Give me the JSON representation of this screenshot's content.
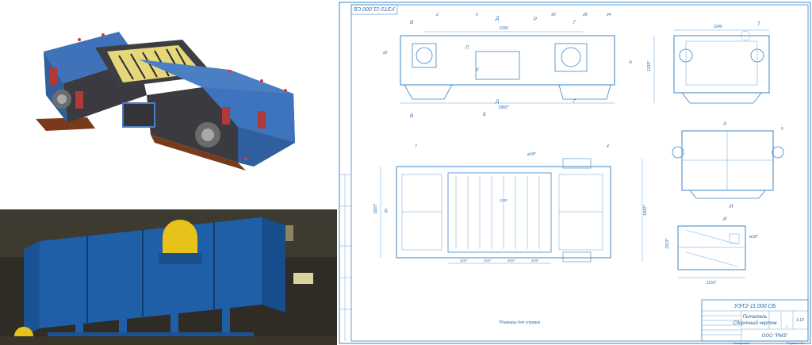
{
  "render": {
    "alt": "3D model of feeder"
  },
  "photo": {
    "alt": "Photo of assembled feeder in workshop"
  },
  "drawing": {
    "stamp_top": "УЭТ2-11.000 СБ",
    "views": {
      "a": "А",
      "b": "Б",
      "v": "В",
      "g": "Г",
      "d": "Д",
      "i": "И",
      "p": "П",
      "r": "Р",
      "t": "Т",
      "u": "У"
    },
    "dims": {
      "d1": "1240",
      "d2": "3965*",
      "d3": "1240",
      "d4": "1235*",
      "d5": "1503*",
      "d6": "1120",
      "d7": "1820*",
      "d8": "1800*",
      "d9": "415*",
      "d10": "415*",
      "d11": "415*",
      "d12": "415*",
      "d13": "ø18*",
      "d14": "ø18*",
      "d15": "1155*"
    },
    "callouts": [
      "22",
      "2",
      "6",
      "28",
      "30",
      "24",
      "25",
      "5",
      "7",
      "4"
    ],
    "note": "*Размеры для справок",
    "title_block": {
      "doc_number": "УЭТ2-11.000 СБ",
      "name_line1": "Питатель",
      "name_line2": "Сборочный чертеж",
      "company": "ООО \"РМЗ\"",
      "scale": "1:10",
      "sheet": "1",
      "copied": "Копировал",
      "format": "Формат A1"
    }
  }
}
